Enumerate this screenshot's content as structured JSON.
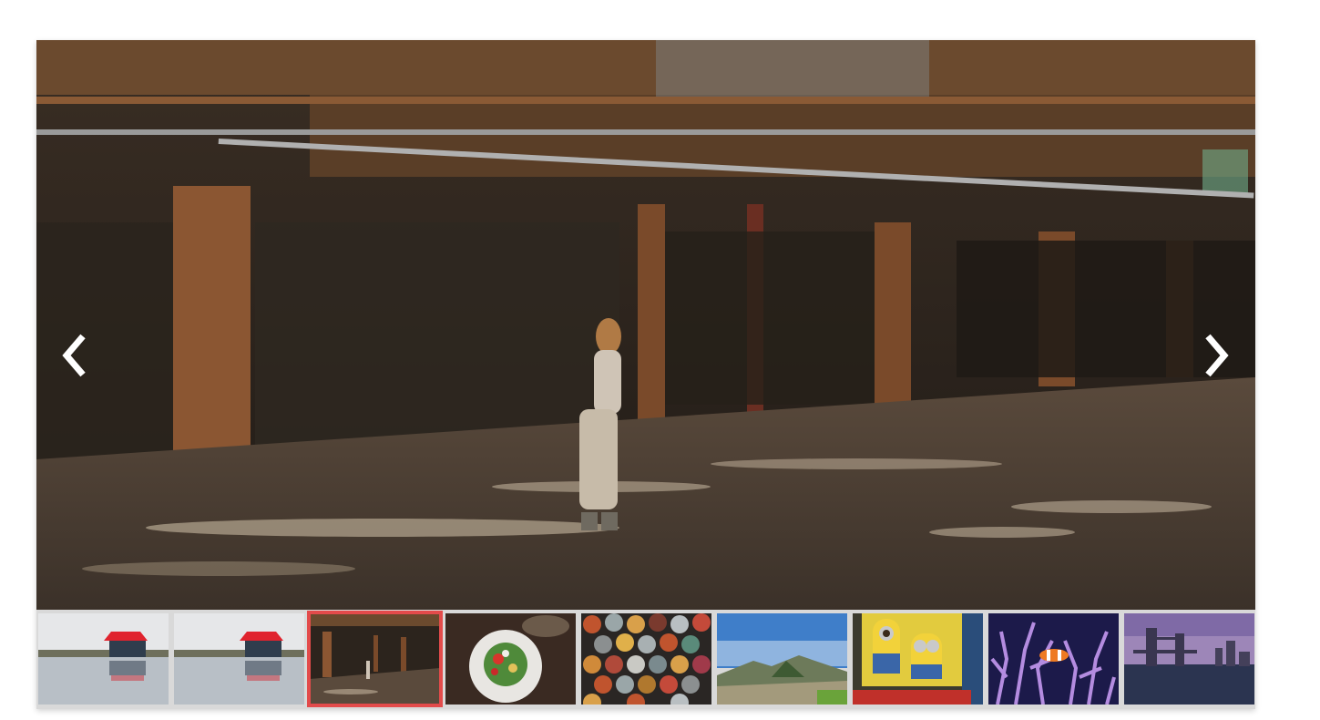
{
  "gallery": {
    "active_index": 2,
    "nav": {
      "prev_icon": "chevron-left-icon",
      "next_icon": "chevron-right-icon",
      "arrow_color": "#ffffff"
    },
    "accent_color": "#e34b4b",
    "thumbnails": [
      {
        "subject": "red-roof-house-lake"
      },
      {
        "subject": "red-roof-house-lake"
      },
      {
        "subject": "industrial-warehouse-woman"
      },
      {
        "subject": "salad-plate"
      },
      {
        "subject": "spray-paint-cans"
      },
      {
        "subject": "mountain-volcano-landscape"
      },
      {
        "subject": "minion-toys"
      },
      {
        "subject": "clownfish-coral"
      },
      {
        "subject": "tower-bridge-london"
      }
    ]
  }
}
